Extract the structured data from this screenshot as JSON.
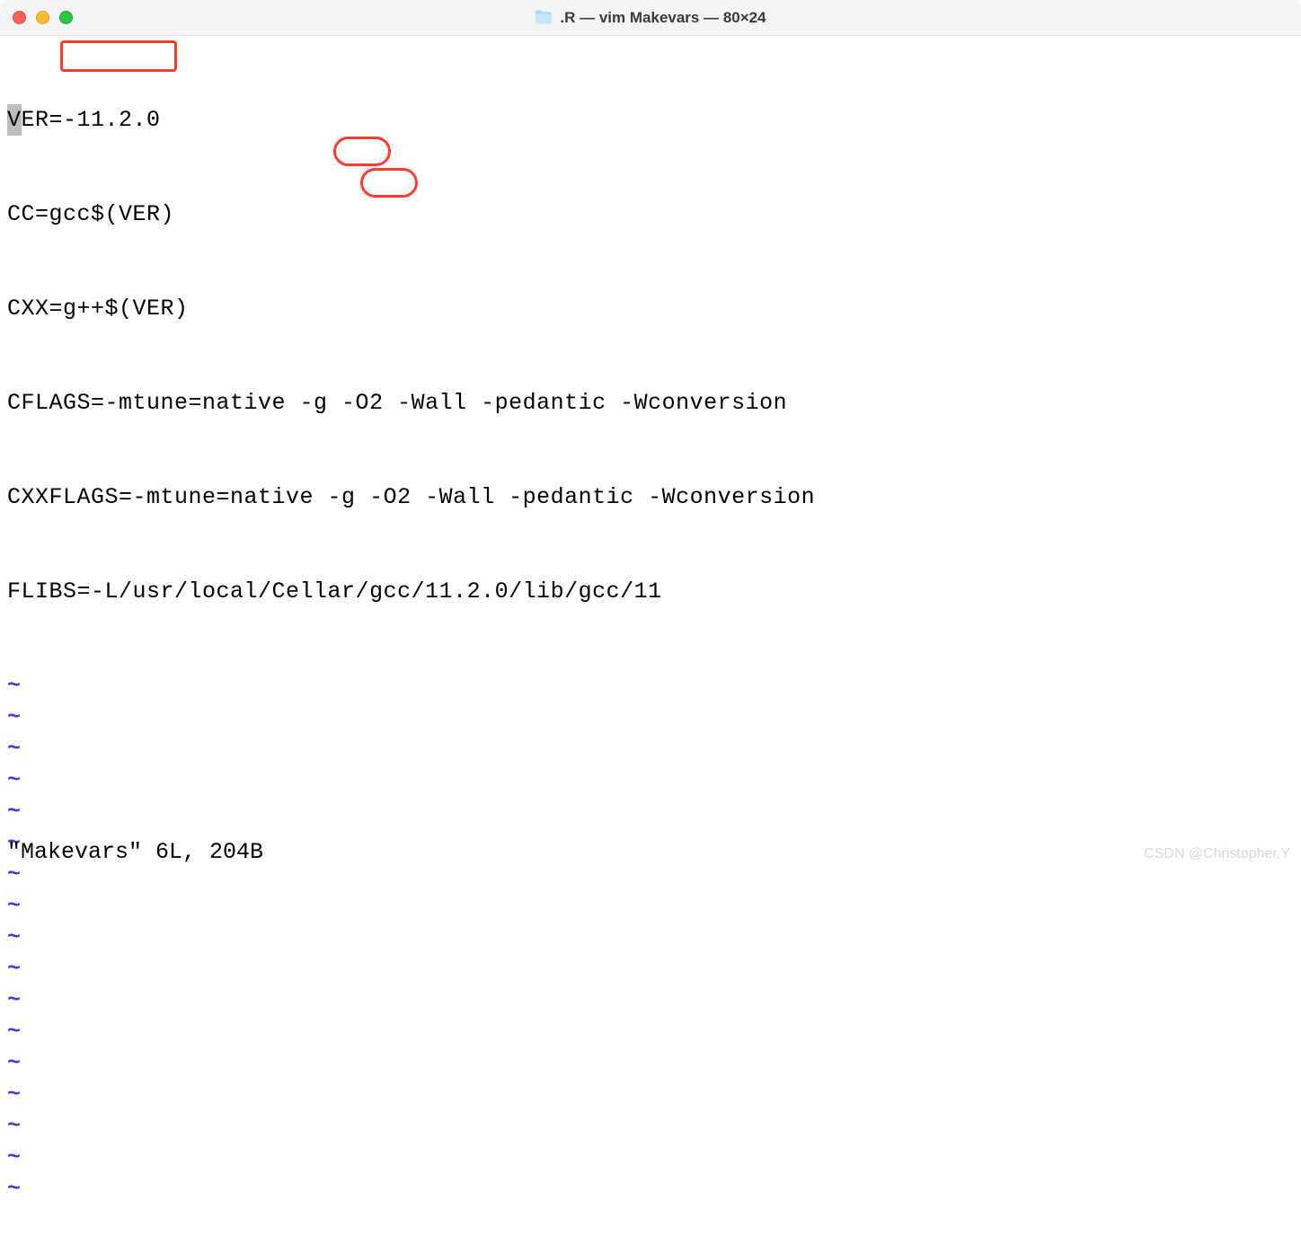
{
  "window": {
    "title": ".R — vim Makevars — 80×24"
  },
  "editor": {
    "lines": [
      "VER=-11.2.0",
      "CC=gcc$(VER)",
      "CXX=g++$(VER)",
      "CFLAGS=-mtune=native -g -O2 -Wall -pedantic -Wconversion",
      "CXXFLAGS=-mtune=native -g -O2 -Wall -pedantic -Wconversion",
      "FLIBS=-L/usr/local/Cellar/gcc/11.2.0/lib/gcc/11"
    ],
    "tilde": "~",
    "tilde_rows": 17,
    "status_line": "\"Makevars\" 6L, 204B"
  },
  "annotations": {
    "version_box": "-11.2.0",
    "opt_flag": "-O2"
  },
  "watermark": "CSDN @Christopher.Y"
}
